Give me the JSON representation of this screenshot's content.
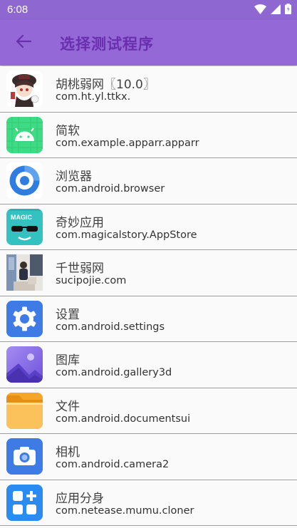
{
  "status": {
    "time": "6:08",
    "wifi_icon": "wifi-icon",
    "signal_icon": "cell-signal-icon",
    "battery_icon": "battery-icon"
  },
  "appbar": {
    "title": "选择测试程序",
    "back_icon": "arrow-back-icon"
  },
  "apps": [
    {
      "name": "胡桃弱网〖10.0〗",
      "package": "com.ht.yl.ttkx.",
      "icon": "anime-character-icon"
    },
    {
      "name": "简软",
      "package": "com.example.apparr.apparr",
      "icon": "android-robot-icon"
    },
    {
      "name": "浏览器",
      "package": "com.android.browser",
      "icon": "browser-icon"
    },
    {
      "name": "奇妙应用",
      "package": "com.magicalstory.AppStore",
      "icon": "magic-sunglasses-icon"
    },
    {
      "name": "千世弱网",
      "package": "sucipojie.com",
      "icon": "photo-icon"
    },
    {
      "name": "设置",
      "package": "com.android.settings",
      "icon": "gear-icon"
    },
    {
      "name": "图库",
      "package": "com.android.gallery3d",
      "icon": "gallery-icon"
    },
    {
      "name": "文件",
      "package": "com.android.documentsui",
      "icon": "folder-icon"
    },
    {
      "name": "相机",
      "package": "com.android.camera2",
      "icon": "camera-icon"
    },
    {
      "name": "应用分身",
      "package": "com.netease.mumu.cloner",
      "icon": "app-clone-icon"
    }
  ],
  "colors": {
    "statusbar": "#8e67d1",
    "appbar": "#9468d6",
    "title": "#6a2fae"
  }
}
